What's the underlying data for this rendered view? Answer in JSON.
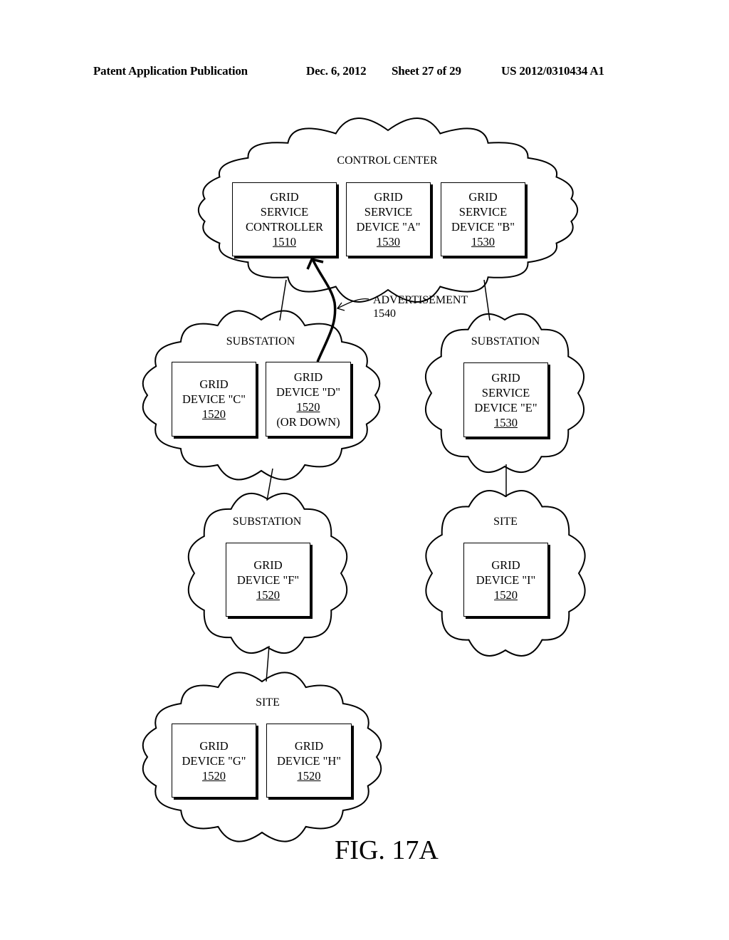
{
  "header": {
    "publication": "Patent Application Publication",
    "date": "Dec. 6, 2012",
    "sheet": "Sheet 27 of 29",
    "number": "US 2012/0310434 A1"
  },
  "clouds": [
    {
      "id": "control-center",
      "label": "CONTROL CENTER"
    },
    {
      "id": "substation-1",
      "label": "SUBSTATION"
    },
    {
      "id": "substation-2",
      "label": "SUBSTATION"
    },
    {
      "id": "substation-3",
      "label": "SUBSTATION"
    },
    {
      "id": "site-1",
      "label": "SITE"
    },
    {
      "id": "site-2",
      "label": "SITE"
    }
  ],
  "boxes": {
    "controller": {
      "lines": [
        "GRID",
        "SERVICE",
        "CONTROLLER"
      ],
      "ref": "1510"
    },
    "device_a": {
      "lines": [
        "GRID",
        "SERVICE",
        "DEVICE \"A\""
      ],
      "ref": "1530"
    },
    "device_b": {
      "lines": [
        "GRID",
        "SERVICE",
        "DEVICE \"B\""
      ],
      "ref": "1530"
    },
    "device_c": {
      "lines": [
        "GRID",
        "DEVICE \"C\""
      ],
      "ref": "1520"
    },
    "device_d": {
      "lines": [
        "GRID",
        "DEVICE \"D\""
      ],
      "ref": "1520",
      "note": "(OR DOWN)"
    },
    "device_e": {
      "lines": [
        "GRID",
        "SERVICE",
        "DEVICE \"E\""
      ],
      "ref": "1530"
    },
    "device_f": {
      "lines": [
        "GRID",
        "DEVICE \"F\""
      ],
      "ref": "1520"
    },
    "device_i": {
      "lines": [
        "GRID",
        "DEVICE \"I\""
      ],
      "ref": "1520"
    },
    "device_g": {
      "lines": [
        "GRID",
        "DEVICE \"G\""
      ],
      "ref": "1520"
    },
    "device_h": {
      "lines": [
        "GRID",
        "DEVICE \"H\""
      ],
      "ref": "1520"
    }
  },
  "advertisement": {
    "label": "ADVERTISEMENT",
    "ref": "1540"
  },
  "caption": "FIG. 17A"
}
